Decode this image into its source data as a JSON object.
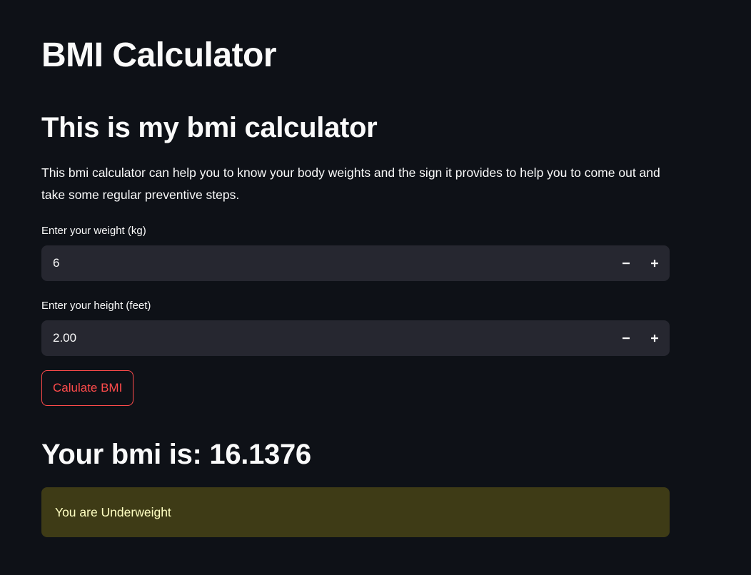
{
  "page": {
    "title": "BMI Calculator",
    "subheader": "This is my bmi calculator",
    "description": "This bmi calculator can help you to know your body weights and the sign it provides to help you to come out and take some regular preventive steps."
  },
  "weight_input": {
    "label": "Enter your weight (kg)",
    "value": "6",
    "decrement_icon": "minus-icon",
    "increment_icon": "plus-icon"
  },
  "height_input": {
    "label": "Enter your height (feet)",
    "value": "2.00",
    "decrement_icon": "minus-icon",
    "increment_icon": "plus-icon"
  },
  "calculate_button": {
    "label": "Calulate BMI"
  },
  "result": {
    "text": "Your bmi is: 16.1376"
  },
  "status_alert": {
    "text": "You are Underweight"
  },
  "colors": {
    "background": "#0e1117",
    "input_background": "#262730",
    "accent": "#ff4b4b",
    "warning_background": "#3e3b16",
    "warning_text": "#ffffc2",
    "text": "#fafafa"
  }
}
